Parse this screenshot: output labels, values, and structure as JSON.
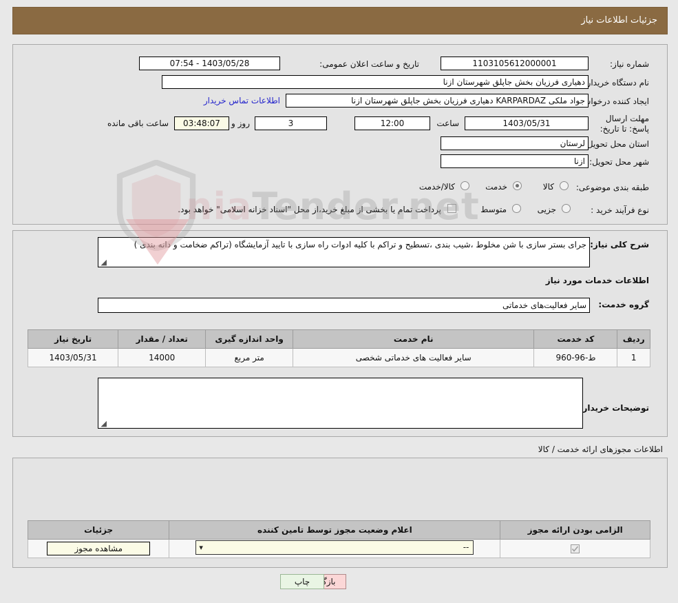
{
  "header": {
    "title": "جزئیات اطلاعات نیاز"
  },
  "fields": {
    "need_number_label": "شماره نیاز:",
    "need_number_value": "1103105612000001",
    "announce_label": "تاریخ و ساعت اعلان عمومی:",
    "announce_value": "1403/05/28 - 07:54",
    "buyer_org_label": "نام دستگاه خریدار:",
    "buyer_org_value": "دهیاری فرزیان بخش جاپلق شهرستان ازنا",
    "creator_label": "ایجاد کننده درخواست:",
    "creator_value": "جواد ملکی KARPARDAZ دهیاری فرزیان بخش جاپلق شهرستان ازنا",
    "contact_link": "اطلاعات تماس خریدار",
    "deadline_label": "مهلت ارسال پاسخ: تا تاریخ:",
    "deadline_date": "1403/05/31",
    "hour_label": "ساعت",
    "hour_value": "12:00",
    "days_value": "3",
    "days_label": "روز و",
    "remaining_value": "03:48:07",
    "remaining_label": "ساعت باقی مانده",
    "province_label": "استان محل تحویل:",
    "province_value": "لرستان",
    "city_label": "شهر محل تحویل:",
    "city_value": "ازنا",
    "category_label": "طبقه بندی موضوعی:",
    "process_label": "نوع فرآیند خرید :",
    "payment_note": "پرداخت تمام یا بخشی از مبلغ خرید،از محل \"اسناد خزانه اسلامی\" خواهد بود."
  },
  "category_options": [
    {
      "label": "کالا",
      "selected": false
    },
    {
      "label": "خدمت",
      "selected": true
    },
    {
      "label": "کالا/خدمت",
      "selected": false
    }
  ],
  "process_options": [
    {
      "label": "جزیی",
      "selected": false
    },
    {
      "label": "متوسط",
      "selected": false
    }
  ],
  "description": {
    "label": "شرح کلی نیاز:",
    "value": "جرای بستر سازی با شن مخلوط ،شیب بندی ،تسطیح و تراکم با کلیه ادوات راه سازی با تایید آزمایشگاه (تراکم ضخامت و دانه بندی )"
  },
  "services_section": {
    "heading": "اطلاعات خدمات مورد نیاز",
    "group_label": "گروه خدمت:",
    "group_value": "سایر فعالیت‌های خدماتی",
    "columns": [
      "ردیف",
      "کد خدمت",
      "نام خدمت",
      "واحد اندازه گیری",
      "تعداد / مقدار",
      "تاریخ نیاز"
    ],
    "rows": [
      {
        "row": "1",
        "code": "ط-96-960",
        "name": "سایر فعالیت های خدماتی شخصی",
        "unit": "متر مربع",
        "quantity": "14000",
        "need_date": "1403/05/31"
      }
    ]
  },
  "buyer_comments": {
    "label": "توضیحات خریدار:",
    "value": ""
  },
  "licenses_section": {
    "subtitle": "اطلاعات مجوزهای ارائه خدمت / کالا",
    "columns": [
      "الزامی بودن ارائه مجوز",
      "اعلام وضعیت مجوز توسط تامین کننده",
      "جزئیات"
    ],
    "rows": [
      {
        "required": true,
        "status_value": "--",
        "details_button": "مشاهده مجوز"
      }
    ]
  },
  "footer": {
    "back_label": "بازگشت",
    "print_label": "چاپ"
  },
  "watermark": {
    "text_left": "nia",
    "text_mid": "Tender",
    "text_right": ".net"
  }
}
